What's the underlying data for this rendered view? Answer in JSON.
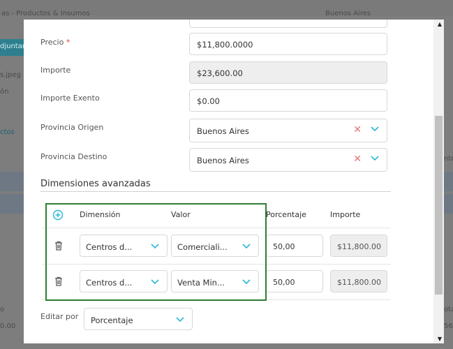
{
  "background": {
    "top_select_text": "as - Productos & Insumos",
    "top_right_text": "Buenos Aires",
    "adjuntar_button": "djuntar",
    "file_text": "s.jpeg",
    "on_text": "ón",
    "tab_text": "ctos",
    "right_col_text": "nto",
    "bottom_left_label": "o",
    "bottom_left_value": "0.00",
    "bottom_right_label": "otal",
    "bottom_right_value": "56."
  },
  "form": {
    "precio": {
      "label": "Precio",
      "required_mark": "*",
      "value": "$11,800.0000"
    },
    "importe": {
      "label": "Importe",
      "value": "$23,600.00"
    },
    "importe_exento": {
      "label": "Importe Exento",
      "value": "$0.00"
    },
    "provincia_origen": {
      "label": "Provincia Origen",
      "value": "Buenos Aires"
    },
    "provincia_destino": {
      "label": "Provincia Destino",
      "value": "Buenos Aires"
    }
  },
  "dimensions": {
    "title": "Dimensiones avanzadas",
    "headers": {
      "dimension": "Dimensión",
      "valor": "Valor",
      "porcentaje": "Porcentaje",
      "importe": "Importe"
    },
    "rows": [
      {
        "dimension": "Centros d...",
        "valor": "Comerciali...",
        "porcentaje": "50,00",
        "importe": "$11,800.00"
      },
      {
        "dimension": "Centros d...",
        "valor": "Venta Min...",
        "porcentaje": "50,00",
        "importe": "$11,800.00"
      }
    ]
  },
  "editar_por": {
    "label": "Editar por",
    "value": "Porcentaje"
  },
  "colors": {
    "accent": "#29b6d6",
    "clear": "#e57373",
    "highlight_box": "#2e7d32"
  }
}
